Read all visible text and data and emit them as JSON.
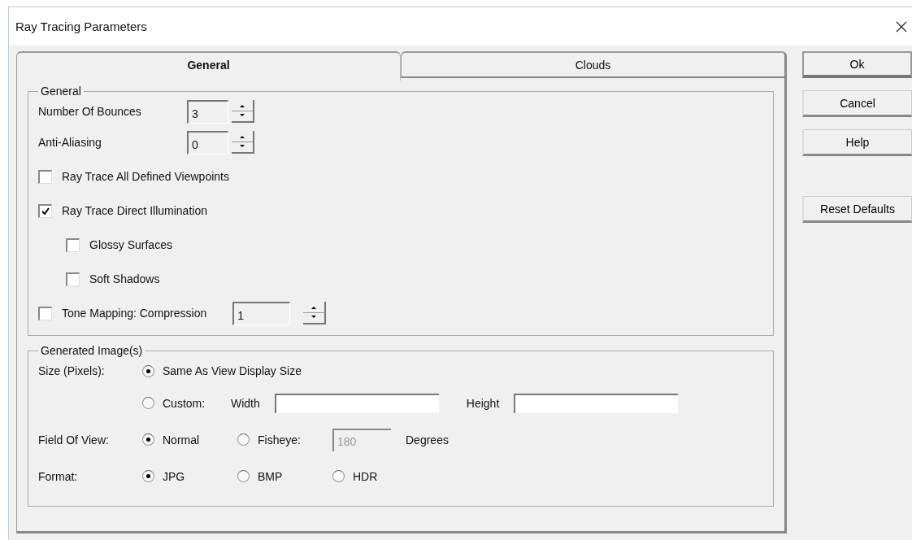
{
  "window": {
    "title": "Ray Tracing Parameters"
  },
  "tabs": [
    {
      "label": "General",
      "selected": true
    },
    {
      "label": "Clouds",
      "selected": false
    }
  ],
  "general_group": {
    "title": "General",
    "spinners": [
      {
        "label": "Number Of Bounces",
        "value": "3"
      },
      {
        "label": "Anti-Aliasing",
        "value": "0"
      }
    ],
    "options": [
      {
        "label": "Ray Trace All Defined Viewpoints",
        "checked": false
      },
      {
        "label": "Ray Trace Direct Illumination",
        "checked": true,
        "children": [
          {
            "label": "Glossy Surfaces",
            "checked": false
          },
          {
            "label": "Soft Shadows",
            "checked": false
          }
        ]
      }
    ],
    "tone_mapping": {
      "label": "Tone Mapping: Compression",
      "checked": false,
      "value": "1"
    }
  },
  "image_group": {
    "title": "Generated Image(s)",
    "size": {
      "label": "Size (Pixels):",
      "options": [
        {
          "label": "Same As View Display Size",
          "selected": true
        },
        {
          "label": "Custom:",
          "selected": false
        }
      ],
      "width_label": "Width",
      "height_label": "Height"
    },
    "field_of_view": {
      "label": "Field Of View:",
      "options": [
        {
          "label": "Normal",
          "selected": true
        },
        {
          "label": "Fisheye:",
          "selected": false
        }
      ],
      "fisheye_value": "180",
      "fisheye_disabled": true,
      "unit": "Degrees"
    },
    "format": {
      "label": "Format:",
      "options": [
        {
          "label": "JPG",
          "selected": true
        },
        {
          "label": "BMP",
          "selected": false
        },
        {
          "label": "HDR",
          "selected": false
        }
      ]
    }
  },
  "buttons": [
    {
      "label": "Ok",
      "default": true
    },
    {
      "label": "Cancel",
      "default": false
    },
    {
      "label": "Help",
      "default": false
    },
    {
      "label": "Reset Defaults",
      "default": false
    }
  ]
}
